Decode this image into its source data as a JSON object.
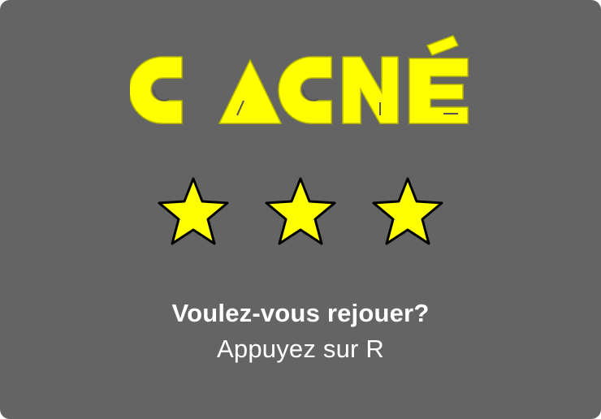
{
  "dialog": {
    "title": "GAGNÉ",
    "stars_earned": 3,
    "stars_total": 3,
    "question": "Voulez-vous rejouer?",
    "action": "Appuyez sur R"
  },
  "colors": {
    "panel_background": "#646464",
    "title_fill": "#ffff00",
    "star_fill": "#ffff00",
    "star_outline": "#000000",
    "text": "#ffffff"
  },
  "icons": {
    "star": "star-icon"
  }
}
